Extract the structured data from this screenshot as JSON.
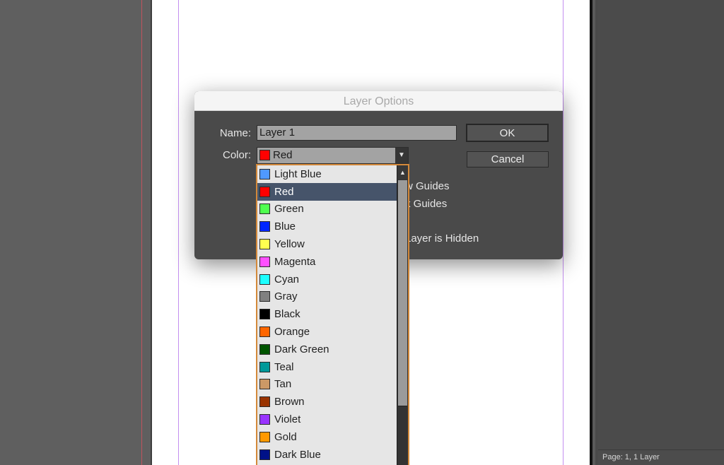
{
  "dialog": {
    "title": "Layer Options",
    "name_label": "Name:",
    "name_value": "Layer 1",
    "color_label": "Color:",
    "color_value": "Red",
    "color_value_swatch": "#ff0000",
    "ok_label": "OK",
    "cancel_label": "Cancel",
    "partial_options": [
      "w Guides",
      "k Guides",
      "Layer is Hidden"
    ]
  },
  "dropdown": {
    "selected": "Red",
    "items": [
      {
        "label": "Light Blue",
        "color": "#4f99ff"
      },
      {
        "label": "Red",
        "color": "#ff0000"
      },
      {
        "label": "Green",
        "color": "#4fff4f"
      },
      {
        "label": "Blue",
        "color": "#0026ff"
      },
      {
        "label": "Yellow",
        "color": "#ffff4f"
      },
      {
        "label": "Magenta",
        "color": "#ff4fff"
      },
      {
        "label": "Cyan",
        "color": "#1cffff"
      },
      {
        "label": "Gray",
        "color": "#808080"
      },
      {
        "label": "Black",
        "color": "#000000"
      },
      {
        "label": "Orange",
        "color": "#ff6600"
      },
      {
        "label": "Dark Green",
        "color": "#005500"
      },
      {
        "label": "Teal",
        "color": "#009999"
      },
      {
        "label": "Tan",
        "color": "#cc9966"
      },
      {
        "label": "Brown",
        "color": "#993300"
      },
      {
        "label": "Violet",
        "color": "#9933ff"
      },
      {
        "label": "Gold",
        "color": "#ff9900"
      },
      {
        "label": "Dark Blue",
        "color": "#001188"
      }
    ]
  },
  "panel": {
    "status": "Page: 1, 1 Layer"
  }
}
